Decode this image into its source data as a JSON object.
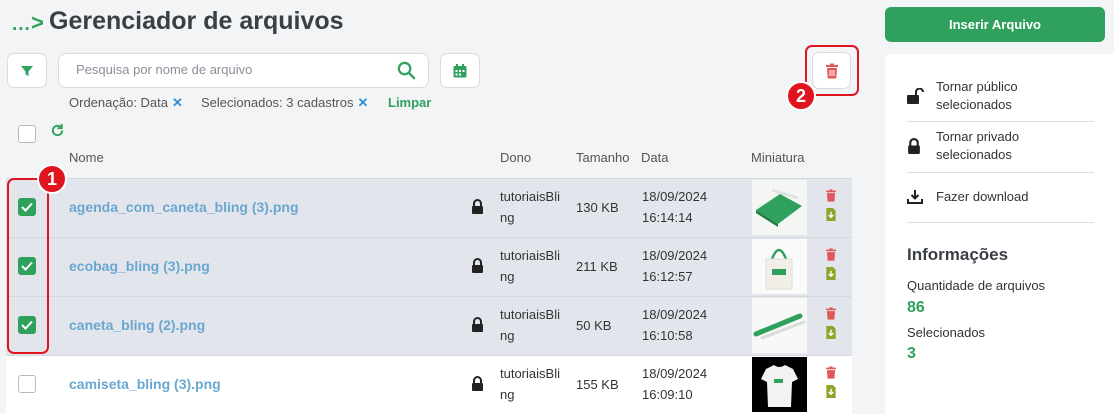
{
  "header": {
    "breadcrumb_dots": "...",
    "breadcrumb_sep": ">",
    "title": "Gerenciador de arquivos"
  },
  "toolbar": {
    "search_placeholder": "Pesquisa por nome de arquivo",
    "search_value": ""
  },
  "filters": {
    "ordering": "Ordenação: Data",
    "selected": "Selecionados: 3 cadastros",
    "clear": "Limpar",
    "remove_glyph": "✕"
  },
  "table": {
    "columns": {
      "name": "Nome",
      "owner": "Dono",
      "size": "Tamanho",
      "date": "Data",
      "thumb": "Miniatura"
    },
    "rows": [
      {
        "name": "agenda_com_caneta_bling (3).png",
        "owner1": "tutoriaisBli",
        "owner2": "ng",
        "size": "130 KB",
        "date": "18/09/2024",
        "time": "16:14:14",
        "checked": true
      },
      {
        "name": "ecobag_bling (3).png",
        "owner1": "tutoriaisBli",
        "owner2": "ng",
        "size": "211 KB",
        "date": "18/09/2024",
        "time": "16:12:57",
        "checked": true
      },
      {
        "name": "caneta_bling (2).png",
        "owner1": "tutoriaisBli",
        "owner2": "ng",
        "size": "50 KB",
        "date": "18/09/2024",
        "time": "16:10:58",
        "checked": true
      },
      {
        "name": "camiseta_bling (3).png",
        "owner1": "tutoriaisBli",
        "owner2": "ng",
        "size": "155 KB",
        "date": "18/09/2024",
        "time": "16:09:10",
        "checked": false
      }
    ]
  },
  "annotations": {
    "badge1": "1",
    "badge2": "2"
  },
  "panel": {
    "insert": "Inserir Arquivo",
    "actions": [
      {
        "line1": "Tornar público",
        "line2": "selecionados"
      },
      {
        "line1": "Tornar privado",
        "line2": "selecionados"
      },
      {
        "line1": "Fazer download",
        "line2": ""
      }
    ],
    "info_title": "Informações",
    "qty_label": "Quantidade de arquivos",
    "qty_value": "86",
    "sel_label": "Selecionados",
    "sel_value": "3"
  },
  "colors": {
    "accent": "#2fa15c",
    "danger": "#e05858",
    "link": "#6aa7d0",
    "highlight": "#e0141e",
    "download": "#8aa62b"
  }
}
